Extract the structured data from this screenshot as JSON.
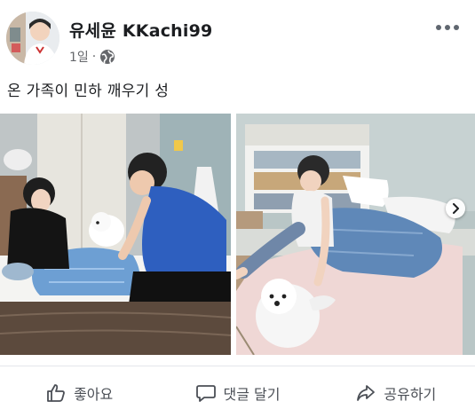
{
  "post": {
    "author": "유세윤 KKachi99",
    "time": "1일",
    "separator": "·",
    "text": "온 가족이 민하 깨우기 성"
  },
  "icons": {
    "avatar": "avatar-photo",
    "privacy": "globe-icon",
    "more": "more-options-icon",
    "next": "chevron-right-icon",
    "like": "thumbs-up-icon",
    "comment": "comment-bubble-icon",
    "share": "share-arrow-icon"
  },
  "photos": [
    {
      "alt": "family waking child on bed with white dog"
    },
    {
      "alt": "child sitting up in bed next to white dog"
    }
  ],
  "actions": {
    "like_label": "좋아요",
    "comment_label": "댓글 달기",
    "share_label": "공유하기"
  },
  "colors": {
    "text": "#1c1e21",
    "meta": "#65676b",
    "action": "#4b4f56",
    "divider": "#e4e6eb"
  }
}
